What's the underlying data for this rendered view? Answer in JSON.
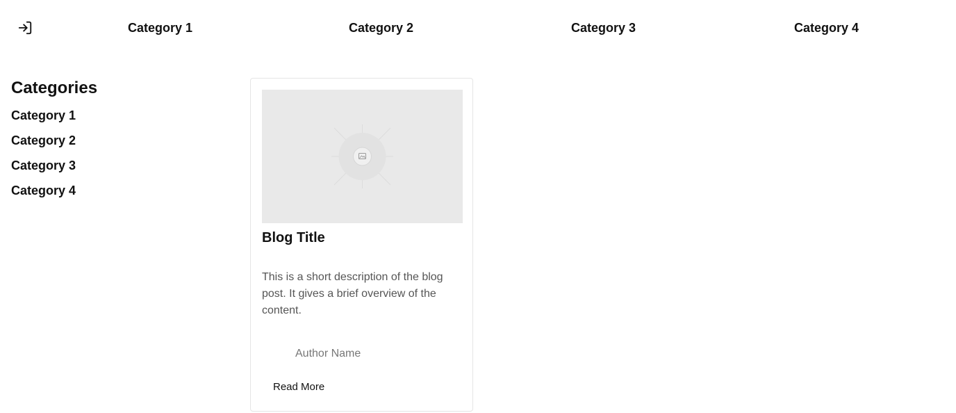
{
  "header": {
    "login_icon": "login-icon",
    "nav": [
      {
        "label": "Category 1"
      },
      {
        "label": "Category 2"
      },
      {
        "label": "Category 3"
      },
      {
        "label": "Category 4"
      }
    ]
  },
  "sidebar": {
    "title": "Categories",
    "items": [
      {
        "label": "Category 1"
      },
      {
        "label": "Category 2"
      },
      {
        "label": "Category 3"
      },
      {
        "label": "Category 4"
      }
    ]
  },
  "card": {
    "image_icon": "image-placeholder-icon",
    "title": "Blog Title",
    "description": "This is a short description of the blog post. It gives a brief overview of the content.",
    "author": "Author Name",
    "read_more": "Read More"
  }
}
